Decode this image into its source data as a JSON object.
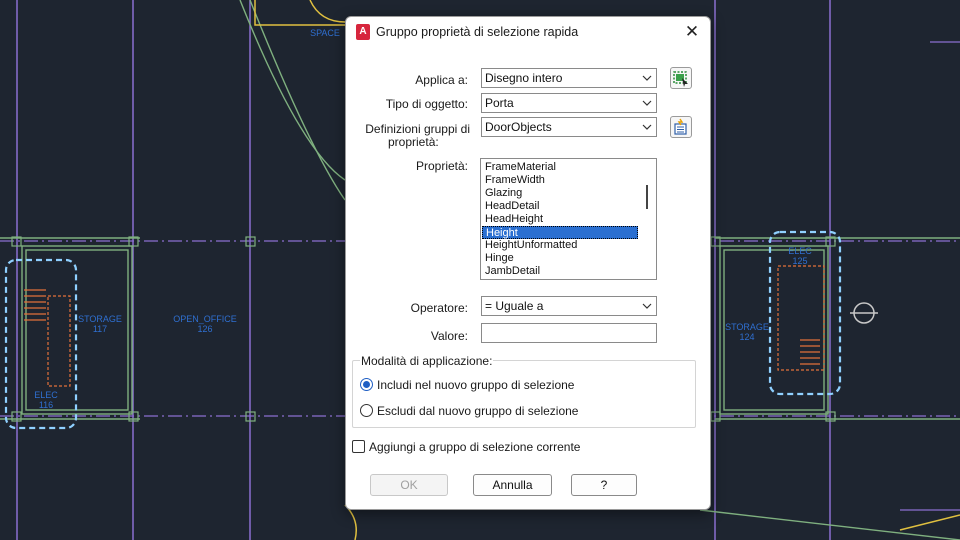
{
  "dialog": {
    "title": "Gruppo proprietà di selezione rapida",
    "close_glyph": "✕",
    "app_icon_letter": "A",
    "apply_to": {
      "label": "Applica a:",
      "value": "Disegno intero"
    },
    "object_type": {
      "label": "Tipo di oggetto:",
      "value": "Porta"
    },
    "property_set_defs": {
      "label_line1": "Definizioni gruppi di",
      "label_line2": "proprietà:",
      "value": "DoorObjects"
    },
    "properties": {
      "label": "Proprietà:",
      "items": [
        "FrameMaterial",
        "FrameWidth",
        "Glazing",
        "HeadDetail",
        "HeadHeight",
        "Height",
        "HeightUnformatted",
        "Hinge",
        "JambDetail"
      ],
      "selected": "Height"
    },
    "operator": {
      "label": "Operatore:",
      "value": "= Uguale a"
    },
    "value_field": {
      "label": "Valore:",
      "value": ""
    },
    "apply_mode": {
      "caption": "Modalità di applicazione:",
      "include": "Includi nel nuovo gruppo di selezione",
      "exclude": "Escludi dal nuovo gruppo di selezione",
      "selected": "include"
    },
    "append": {
      "label": "Aggiungi a gruppo di selezione corrente",
      "checked": false
    },
    "buttons": {
      "ok": "OK",
      "cancel": "Annulla",
      "help": "?"
    }
  },
  "drawing": {
    "room_labels": [
      {
        "name": "STORAGE",
        "number": "117"
      },
      {
        "name": "OPEN_OFFICE",
        "number": "126"
      },
      {
        "name": "ELEC",
        "number": "116"
      },
      {
        "name": "STORAGE",
        "number": "124"
      },
      {
        "name": "ELEC",
        "number": "125"
      }
    ],
    "tag": "SPACE",
    "colors": {
      "background": "#1e2530",
      "grid": "#8a6fd0",
      "walls": "#7fb07f",
      "highlight": "#8fd0ff",
      "stairs": "#e2703a",
      "text": "#2f6fd0",
      "door": "#e0c040"
    }
  }
}
